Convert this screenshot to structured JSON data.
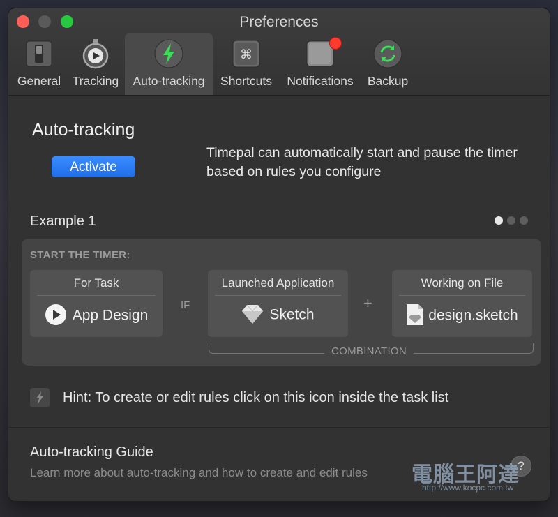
{
  "window": {
    "title": "Preferences"
  },
  "tabs": [
    {
      "label": "General",
      "icon": "switch-icon"
    },
    {
      "label": "Tracking",
      "icon": "stopwatch-icon"
    },
    {
      "label": "Auto-tracking",
      "icon": "lightning-icon",
      "active": true
    },
    {
      "label": "Shortcuts",
      "icon": "command-key-icon"
    },
    {
      "label": "Notifications",
      "icon": "notification-icon"
    },
    {
      "label": "Backup",
      "icon": "sync-icon"
    }
  ],
  "main": {
    "title": "Auto-tracking",
    "activate_label": "Activate",
    "description": "Timepal can automatically start and pause the timer based on rules you configure",
    "example_title": "Example 1",
    "page_dots": {
      "count": 3,
      "active_index": 0
    }
  },
  "rule": {
    "heading": "START THE TIMER:",
    "if_label": "IF",
    "plus_label": "+",
    "combination_label": "COMBINATION",
    "cards": [
      {
        "header": "For Task",
        "value": "App Design",
        "icon": "play-icon"
      },
      {
        "header": "Launched Application",
        "value": "Sketch",
        "icon": "sketch-diamond-icon"
      },
      {
        "header": "Working on File",
        "value": "design.sketch",
        "icon": "document-icon"
      }
    ]
  },
  "hint": {
    "text": "Hint: To create or edit rules click on this icon inside the task list"
  },
  "guide": {
    "title": "Auto-tracking Guide",
    "link": "Learn more about auto-tracking and how to create and edit rules",
    "help_label": "?"
  },
  "watermark": {
    "text": "電腦王阿達",
    "url": "http://www.kocpc.com.tw"
  },
  "colors": {
    "accent": "#1f6fe8",
    "badge": "#ff3b30",
    "bolt": "#3ddc5a"
  }
}
